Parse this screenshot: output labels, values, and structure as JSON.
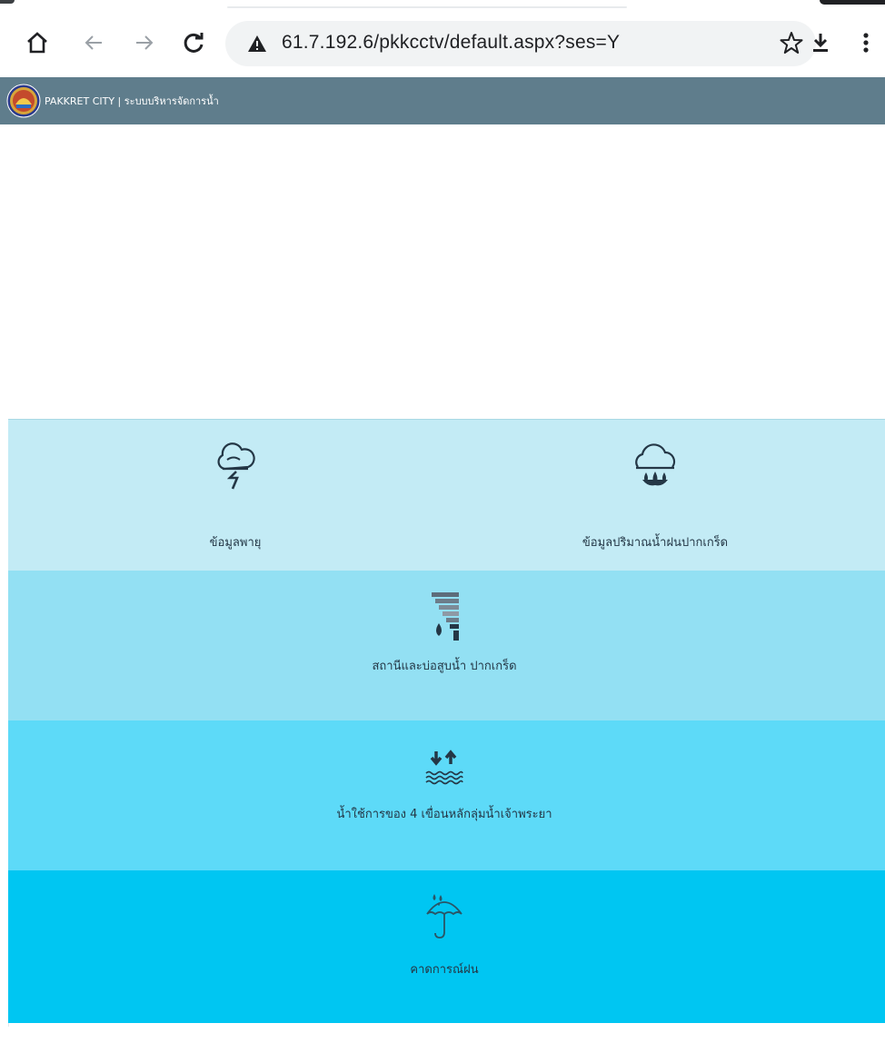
{
  "browser": {
    "url": "61.7.192.6/pkkcctv/default.aspx?ses=Y",
    "icons": [
      "home-icon",
      "back-arrow-icon",
      "forward-arrow-icon",
      "reload-icon",
      "not-secure-warning-icon",
      "bookmark-star-icon",
      "download-icon",
      "more-menu-icon"
    ]
  },
  "header": {
    "title": "PAKKRET CITY | ระบบบริหารจัดการน้ำ",
    "color": "#5f7d8c"
  },
  "menu": {
    "tiles": [
      {
        "label": "ข้อมูลพายุ",
        "icon": "storm-cloud-icon"
      },
      {
        "label": "ข้อมูลปริมาณน้ำฝนปากเกร็ด",
        "icon": "rain-cloud-drops-icon"
      },
      {
        "label": "สถานีและบ่อสูบน้ำ ปากเกร็ด",
        "icon": "water-station-icon"
      },
      {
        "label": "น้ำใช้การของ 4 เขื่อนหลักลุ่มน้ำเจ้าพระยา",
        "icon": "water-level-arrows-icon"
      },
      {
        "label": "คาดการณ์ฝน",
        "icon": "umbrella-rain-icon"
      }
    ],
    "row_colors": [
      "#c3ebf5",
      "#93e0f3",
      "#5ddaf8",
      "#00c6f2"
    ]
  }
}
